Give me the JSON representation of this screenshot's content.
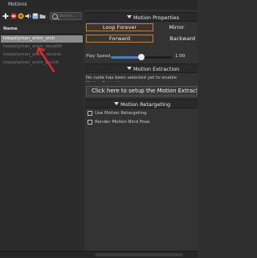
{
  "window": {
    "title": "Motions"
  },
  "toolbar": {
    "icons": [
      "add-icon",
      "remove-icon",
      "import-icon",
      "sound-icon",
      "save-icon",
      "folder-icon"
    ],
    "search_placeholder": "Search..."
  },
  "motion_list": {
    "column_header": "Name",
    "items": [
      {
        "name": "lowpolyman_anim_arch",
        "selected": true
      },
      {
        "name": "lowpolyman_anim_deadlift",
        "selected": false
      },
      {
        "name": "lowpolyman_anim_neutral",
        "selected": false
      },
      {
        "name": "lowpolyman_anim_punch",
        "selected": false
      }
    ]
  },
  "motion_properties": {
    "header": "Motion Properties",
    "loop_forever": "Loop Forever",
    "mirror": "Mirror",
    "forward": "Forward",
    "backward": "Backward",
    "play_speed_label": "Play Speed",
    "play_speed_value": "1.00",
    "play_speed_fraction": 0.5
  },
  "motion_extraction": {
    "header": "Motion Extraction",
    "info_text": "No node has been selected yet to enable Motion Extraction.",
    "setup_button": "Click here to setup the Motion Extraction"
  },
  "motion_retargeting": {
    "header": "Motion Retargeting",
    "use_retargeting": "Use Motion Retargeting",
    "render_bind_pose": "Render Motion Bind Pose"
  },
  "colors": {
    "accent_orange": "#d07a2c",
    "slider_blue": "#4a7fc1",
    "annotation_red": "#e02a2a",
    "selection_gray": "#8a8a8a"
  }
}
